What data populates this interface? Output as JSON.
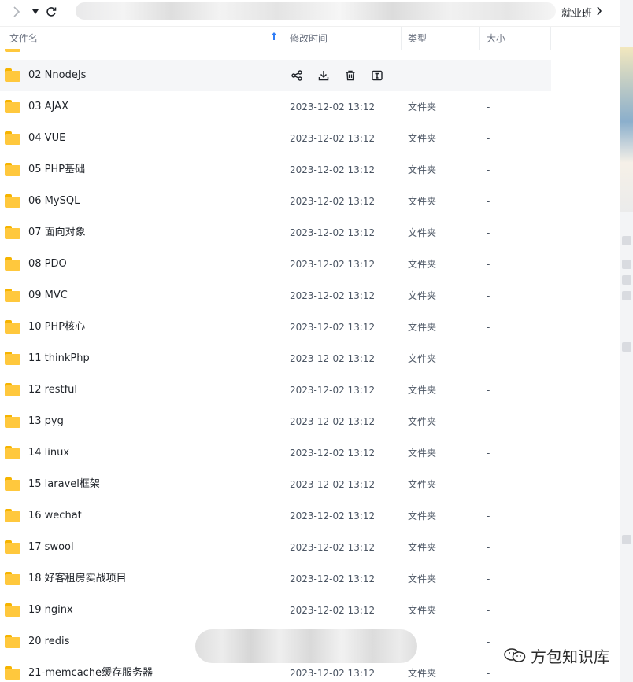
{
  "breadcrumb": {
    "current": "就业班"
  },
  "columns": {
    "name": "文件名",
    "modified": "修改时间",
    "type": "类型",
    "size": "大小"
  },
  "rows": [
    {
      "name": "02 NnodeJs",
      "modified": "",
      "type": "",
      "size": ""
    },
    {
      "name": "03 AJAX",
      "modified": "2023-12-02 13:12",
      "type": "文件夹",
      "size": "-"
    },
    {
      "name": "04 VUE",
      "modified": "2023-12-02 13:12",
      "type": "文件夹",
      "size": "-"
    },
    {
      "name": "05 PHP基础",
      "modified": "2023-12-02 13:12",
      "type": "文件夹",
      "size": "-"
    },
    {
      "name": "06 MySQL",
      "modified": "2023-12-02 13:12",
      "type": "文件夹",
      "size": "-"
    },
    {
      "name": "07 面向对象",
      "modified": "2023-12-02 13:12",
      "type": "文件夹",
      "size": "-"
    },
    {
      "name": "08 PDO",
      "modified": "2023-12-02 13:12",
      "type": "文件夹",
      "size": "-"
    },
    {
      "name": "09 MVC",
      "modified": "2023-12-02 13:12",
      "type": "文件夹",
      "size": "-"
    },
    {
      "name": "10 PHP核心",
      "modified": "2023-12-02 13:12",
      "type": "文件夹",
      "size": "-"
    },
    {
      "name": "11 thinkPhp",
      "modified": "2023-12-02 13:12",
      "type": "文件夹",
      "size": "-"
    },
    {
      "name": "12 restful",
      "modified": "2023-12-02 13:12",
      "type": "文件夹",
      "size": "-"
    },
    {
      "name": "13 pyg",
      "modified": "2023-12-02 13:12",
      "type": "文件夹",
      "size": "-"
    },
    {
      "name": "14 linux",
      "modified": "2023-12-02 13:12",
      "type": "文件夹",
      "size": "-"
    },
    {
      "name": "15 laravel框架",
      "modified": "2023-12-02 13:12",
      "type": "文件夹",
      "size": "-"
    },
    {
      "name": "16 wechat",
      "modified": "2023-12-02 13:12",
      "type": "文件夹",
      "size": "-"
    },
    {
      "name": "17 swool",
      "modified": "2023-12-02 13:12",
      "type": "文件夹",
      "size": "-"
    },
    {
      "name": "18 好客租房实战项目",
      "modified": "2023-12-02 13:12",
      "type": "文件夹",
      "size": "-"
    },
    {
      "name": "19 nginx",
      "modified": "2023-12-02 13:12",
      "type": "文件夹",
      "size": "-"
    },
    {
      "name": "20 redis",
      "modified": "",
      "type": "",
      "size": "-"
    },
    {
      "name": "21-memcache缓存服务器",
      "modified": "2023-12-02 13:12",
      "type": "文件夹",
      "size": "-"
    }
  ],
  "hover_actions": [
    "share-icon",
    "download-icon",
    "delete-icon",
    "rename-icon"
  ],
  "watermark": {
    "text": "方包知识库"
  },
  "colors": {
    "accent": "#2f7cf6",
    "folder": "#ffc83d",
    "hover_row": "#f5f6f8"
  }
}
